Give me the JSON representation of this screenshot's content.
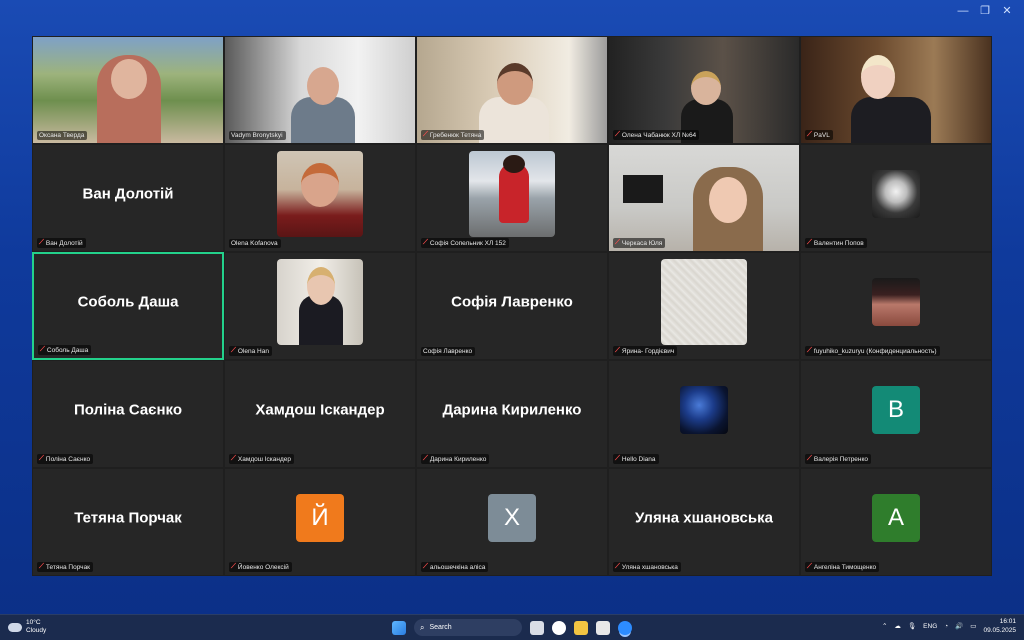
{
  "window": {
    "controls": [
      "—",
      "❐",
      "✕"
    ]
  },
  "tiles": [
    {
      "id": "t0",
      "name": "Оксана Тверда",
      "muted": false
    },
    {
      "id": "t1",
      "name": "Vadym Bronytskyi",
      "muted": false
    },
    {
      "id": "t2",
      "name": "Гребенюк Тетяна",
      "muted": true
    },
    {
      "id": "t3",
      "name": "Олена Чабанюк ХЛ №64",
      "muted": true
    },
    {
      "id": "t4",
      "name": "PaVL",
      "muted": true
    },
    {
      "id": "t5",
      "name": "Ван Долотій",
      "muted": true,
      "bigname": "Ван Долотій"
    },
    {
      "id": "t6",
      "name": "Olena Kofanova",
      "muted": false
    },
    {
      "id": "t7",
      "name": "Софія Сопельник ХЛ 152",
      "muted": true
    },
    {
      "id": "t8",
      "name": "Черкаса Юля",
      "muted": true
    },
    {
      "id": "t9",
      "name": "Валентин Попов",
      "muted": true
    },
    {
      "id": "t10",
      "name": "Соболь Даша",
      "muted": true,
      "bigname": "Соболь Даша"
    },
    {
      "id": "t11",
      "name": "Olena Han",
      "muted": true
    },
    {
      "id": "t12",
      "name": "Софія Лавренко",
      "muted": false,
      "bigname": "Софія Лавренко"
    },
    {
      "id": "t13",
      "name": "Ярина- Гордієвич",
      "muted": true
    },
    {
      "id": "t14",
      "name": "fuyuhiko_kuzuryu (Конфиденциальность)",
      "muted": true
    },
    {
      "id": "t15",
      "name": "Поліна Саєнко",
      "muted": true,
      "bigname": "Поліна Саєнко"
    },
    {
      "id": "t16",
      "name": "Хамдош Іскандер",
      "muted": true,
      "bigname": "Хамдош Іскандер"
    },
    {
      "id": "t17",
      "name": "Дарина Кириленко",
      "muted": true,
      "bigname": "Дарина  Кириленко"
    },
    {
      "id": "t18",
      "name": "Hello Diana",
      "muted": true
    },
    {
      "id": "t19",
      "name": "Валерія Петренко",
      "muted": true,
      "letter": "В",
      "letter_color": "#138a76"
    },
    {
      "id": "t20",
      "name": "Тетяна Порчак",
      "muted": true,
      "bigname": "Тетяна Порчак"
    },
    {
      "id": "t21",
      "name": "Йовенко Олексій",
      "muted": true,
      "letter": "Й",
      "letter_color": "#f07a1c"
    },
    {
      "id": "t22",
      "name": "альошечкіна аліса",
      "muted": true,
      "letter": "Х",
      "letter_color": "#7d8c97"
    },
    {
      "id": "t23",
      "name": "Уляна хшановська",
      "muted": true,
      "bigname": "Уляна  хшановська"
    },
    {
      "id": "t24",
      "name": "Ангеліна Тимощенко",
      "muted": true,
      "letter": "А",
      "letter_color": "#2f7d2c"
    }
  ],
  "taskbar": {
    "weather_temp": "10°C",
    "weather_desc": "Cloudy",
    "search_label": "Search",
    "language": "ENG",
    "time": "16:01",
    "date": "09.05.2025"
  }
}
